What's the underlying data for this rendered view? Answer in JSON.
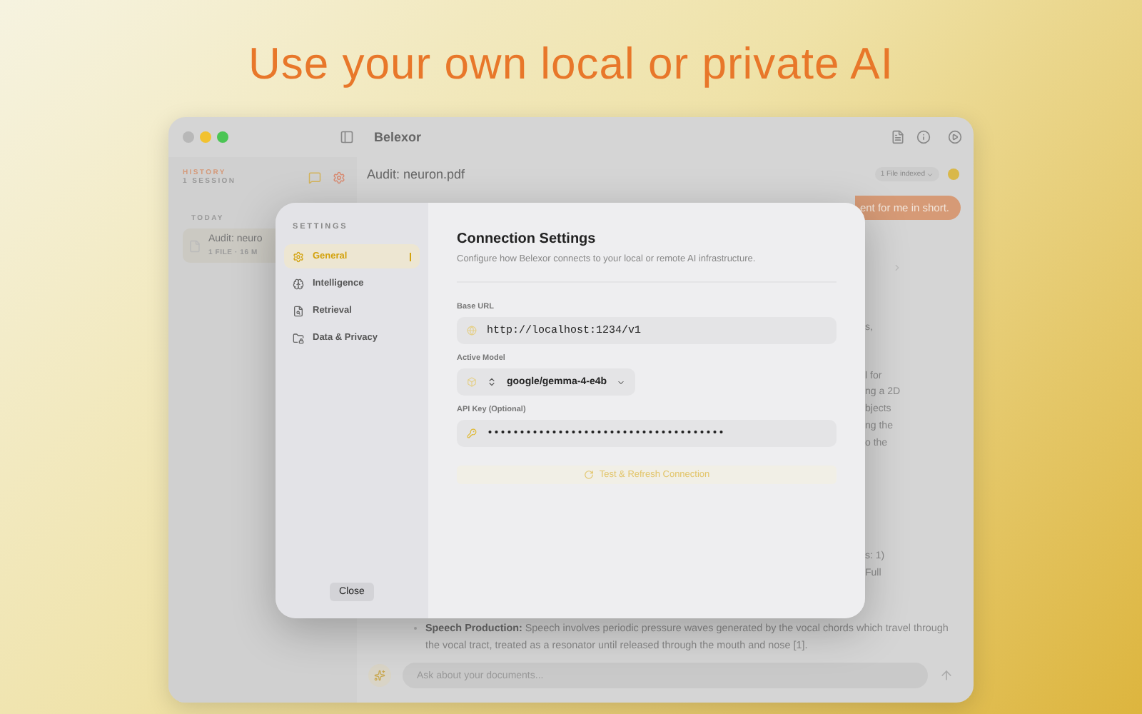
{
  "headline": "Use your own local or private AI",
  "window": {
    "title": "Belexor"
  },
  "sidebar": {
    "header": "HISTORY",
    "count": "1 SESSION",
    "group": "TODAY",
    "sessions": [
      {
        "title": "Audit: neuro",
        "meta": "1 FILE · 16 M",
        "selected": true
      }
    ]
  },
  "document": {
    "title": "Audit: neuron.pdf",
    "indexed": "1 File indexed"
  },
  "chat": {
    "user_message": "ent for me in short.",
    "answer_fragments": [
      [
        "s,"
      ],
      [
        "l for",
        "ng a 2D",
        "bjects",
        "ng the",
        "o the"
      ],
      [
        "s: 1)",
        "Full"
      ]
    ],
    "bullet": "**Speech Production:** Speech involves periodic pressure waves generated by the vocal chords which travel through the vocal tract, treated as a resonator until released through the mouth and nose [1]."
  },
  "composer": {
    "placeholder": "Ask about your documents..."
  },
  "settings": {
    "heading": "SETTINGS",
    "nav": [
      {
        "label": "General",
        "selected": true
      },
      {
        "label": "Intelligence",
        "selected": false
      },
      {
        "label": "Retrieval",
        "selected": false
      },
      {
        "label": "Data & Privacy",
        "selected": false
      }
    ],
    "close": "Close",
    "title": "Connection Settings",
    "subtitle": "Configure how Belexor connects to your local or remote AI infrastructure.",
    "fields": [
      {
        "kind": "text",
        "label": "Base URL",
        "value": "http://localhost:1234/v1"
      },
      {
        "kind": "select",
        "label": "Active Model",
        "value": "google/gemma-4-e4b"
      },
      {
        "kind": "secret",
        "label": "API Key (Optional)",
        "value": "•••••••••••••••••••••••••••••••••••••"
      }
    ],
    "action": "Test & Refresh Connection"
  }
}
